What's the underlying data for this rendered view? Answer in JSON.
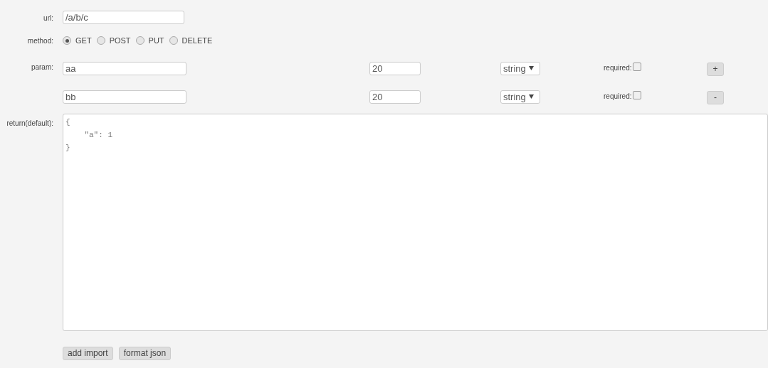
{
  "url": {
    "label": "url:",
    "value": "/a/b/c"
  },
  "method": {
    "label": "method:",
    "options": [
      {
        "label": "GET",
        "selected": true
      },
      {
        "label": "POST",
        "selected": false
      },
      {
        "label": "PUT",
        "selected": false
      },
      {
        "label": "DELETE",
        "selected": false
      }
    ]
  },
  "params": {
    "label": "param:",
    "rows": [
      {
        "name": "aa",
        "size": "20",
        "type": "string",
        "required_label": "required:",
        "required": false,
        "button": "+"
      },
      {
        "name": "bb",
        "size": "20",
        "type": "string",
        "required_label": "required:",
        "required": false,
        "button": "-"
      }
    ]
  },
  "return": {
    "label": "return(default):",
    "value": "{\n    \"a\": 1\n}"
  },
  "buttons": [
    "add import",
    "format json"
  ]
}
